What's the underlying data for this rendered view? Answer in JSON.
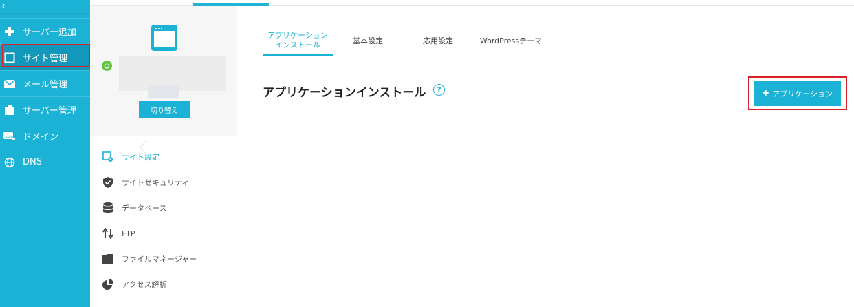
{
  "nav": {
    "collapse_label": "‹",
    "items": [
      {
        "label": "サーバー追加",
        "icon": "plus-icon"
      },
      {
        "label": "サイト管理",
        "icon": "window-icon"
      },
      {
        "label": "メール管理",
        "icon": "mail-icon"
      },
      {
        "label": "サーバー管理",
        "icon": "server-icon"
      },
      {
        "label": "ドメイン",
        "icon": "domain-icon"
      },
      {
        "label": "DNS",
        "icon": "globe-icon"
      }
    ]
  },
  "site_panel": {
    "switch_label": "切り替え",
    "menu": [
      {
        "label": "サイト設定",
        "icon": "site-settings-icon"
      },
      {
        "label": "サイトセキュリティ",
        "icon": "shield-icon"
      },
      {
        "label": "データベース",
        "icon": "database-icon"
      },
      {
        "label": "FTP",
        "icon": "transfer-icon"
      },
      {
        "label": "ファイルマネージャー",
        "icon": "folder-icon"
      },
      {
        "label": "アクセス解析",
        "icon": "pie-chart-icon"
      }
    ]
  },
  "main": {
    "tabs": [
      {
        "label_line1": "アプリケーション",
        "label_line2": "インストール"
      },
      {
        "label": "基本設定"
      },
      {
        "label": "応用設定"
      },
      {
        "label": "WordPressテーマ"
      }
    ],
    "page_title": "アプリケーションインストール",
    "help_glyph": "?",
    "add_button_label": "アプリケーション",
    "add_button_glyph": "+"
  },
  "colors": {
    "accent": "#1cb2d6",
    "nav_active": "#1397ba",
    "highlight": "#d6232a",
    "status_on": "#64c243"
  }
}
